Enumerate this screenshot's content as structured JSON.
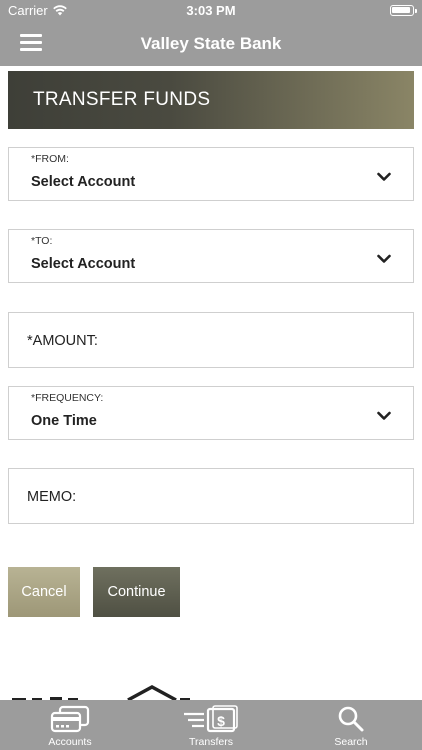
{
  "status_bar": {
    "carrier": "Carrier",
    "time": "3:03 PM"
  },
  "nav": {
    "title": "Valley State Bank"
  },
  "banner": {
    "title": "TRANSFER FUNDS"
  },
  "form": {
    "from": {
      "label": "*FROM:",
      "value": "Select Account"
    },
    "to": {
      "label": "*TO:",
      "value": "Select Account"
    },
    "amount": {
      "label": "*AMOUNT:"
    },
    "frequency": {
      "label": "*FREQUENCY:",
      "value": "One Time"
    },
    "memo": {
      "label": "MEMO:"
    }
  },
  "buttons": {
    "cancel": "Cancel",
    "continue": "Continue"
  },
  "tabs": [
    {
      "label": "Accounts",
      "icon": "credit-card-icon"
    },
    {
      "label": "Transfers",
      "icon": "transfer-money-icon"
    },
    {
      "label": "Search",
      "icon": "search-icon"
    }
  ],
  "colors": {
    "chrome": "#9c9c9c",
    "banner_dark": "#3e3f38",
    "banner_light": "#8a8566",
    "cancel_button": "#a9a484",
    "continue_button": "#5c5d4f"
  }
}
